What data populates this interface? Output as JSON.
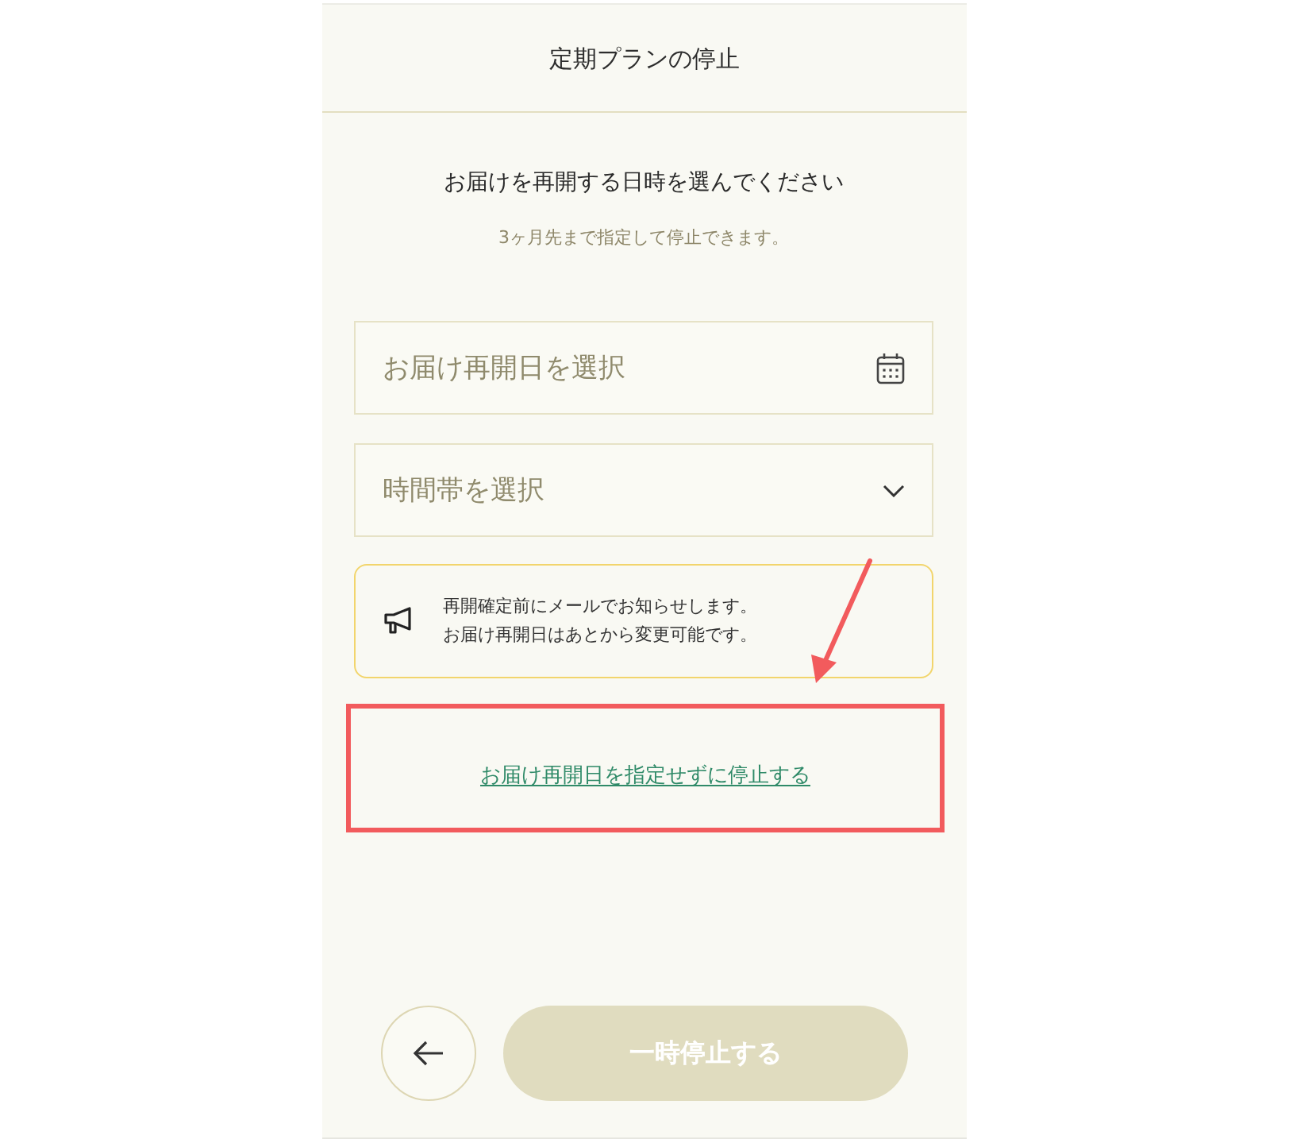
{
  "header": {
    "title": "定期プランの停止"
  },
  "prompt": {
    "heading": "お届けを再開する日時を選んでください",
    "note": "3ヶ月先まで指定して停止できます。"
  },
  "fields": [
    {
      "kind": "date",
      "placeholder": "お届け再開日を選択"
    },
    {
      "kind": "select",
      "placeholder": "時間帯を選択"
    }
  ],
  "notice": {
    "lines": [
      "再開確定前にメールでお知らせします。",
      "お届け再開日はあとから変更可能です。"
    ]
  },
  "skip_link": {
    "label": "お届け再開日を指定せずに停止する"
  },
  "footer": {
    "submit": {
      "label": "一時停止する",
      "disabled": true
    }
  }
}
